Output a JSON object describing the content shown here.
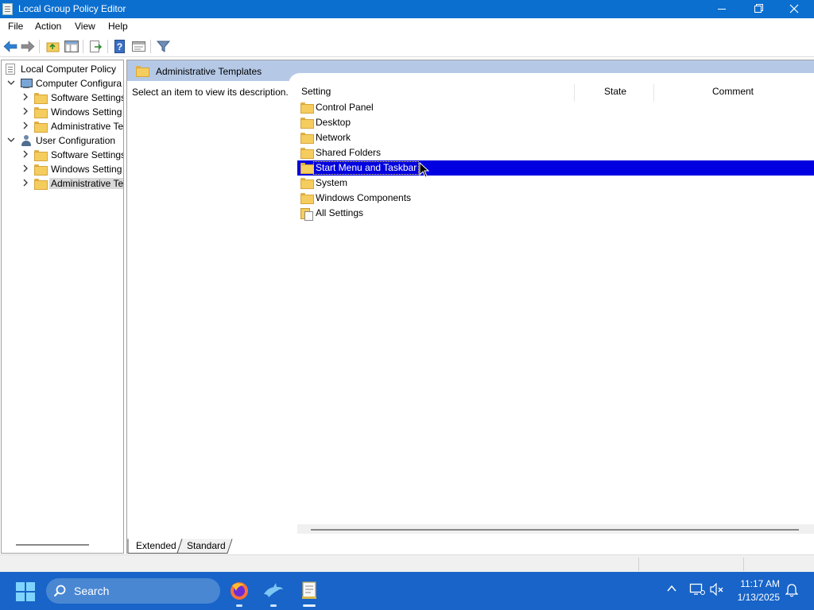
{
  "window": {
    "title": "Local Group Policy Editor",
    "accent_color": "#0b6fd0"
  },
  "menu": [
    "File",
    "Action",
    "View",
    "Help"
  ],
  "toolbar_icons": [
    "back-arrow-icon",
    "forward-arrow-icon",
    "up-folder-icon",
    "show-hide-tree-icon",
    "export-list-icon",
    "help-icon",
    "properties-icon",
    "filter-icon"
  ],
  "tree": {
    "root": "Local Computer Policy",
    "computer_config": "Computer Configura",
    "cc_software": "Software Settings",
    "cc_windows": "Windows Setting",
    "cc_admin": "Administrative Te",
    "user_config": "User Configuration",
    "uc_software": "Software Settings",
    "uc_windows": "Windows Setting",
    "uc_admin": "Administrative Te"
  },
  "right": {
    "header_title": "Administrative Templates",
    "description": "Select an item to view its description.",
    "columns": {
      "setting": "Setting",
      "state": "State",
      "comment": "Comment"
    },
    "items": [
      {
        "label": "Control Panel",
        "icon": "folder-icon"
      },
      {
        "label": "Desktop",
        "icon": "folder-icon"
      },
      {
        "label": "Network",
        "icon": "folder-icon"
      },
      {
        "label": "Shared Folders",
        "icon": "folder-icon"
      },
      {
        "label": "Start Menu and Taskbar",
        "icon": "folder-icon",
        "selected": true
      },
      {
        "label": "System",
        "icon": "folder-icon"
      },
      {
        "label": "Windows Components",
        "icon": "folder-icon"
      },
      {
        "label": "All Settings",
        "icon": "all-settings-icon"
      }
    ],
    "selection_color": "#0000e0"
  },
  "tabs": {
    "extended": "Extended",
    "standard": "Standard"
  },
  "taskbar": {
    "search_placeholder": "Search",
    "apps": [
      "firefox-icon",
      "dolphin-icon",
      "policy-editor-icon"
    ],
    "time": "11:17 AM",
    "date": "1/13/2025",
    "color": "#1864c8"
  }
}
